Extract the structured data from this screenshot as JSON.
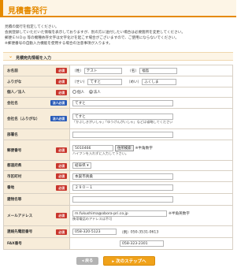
{
  "page_title": "見積書発行",
  "intro": [
    "見積の発行を指定してください。",
    "会員登録していただいた情報を表示しておりますが、別の方に送付したい場合は必要箇所を変更してください。",
    "郵便ＥＮＤ◎ 等の機種依存文字は文字化けを起こす場合がございますので、ご使用にならないでください。",
    "※郵便番号の自動入力機能を使用する場合の注意事項が入ります。"
  ],
  "section_title": "見積宛先情報を入力",
  "badges": {
    "required": "必須",
    "corp_required": "法人必須"
  },
  "form": {
    "name": {
      "label": "お名前",
      "sei_prefix": "（姓）",
      "sei": "テスト",
      "mei_prefix": "（名）",
      "mei": "福島"
    },
    "kana": {
      "label": "ふりがな",
      "sei_prefix": "（せい）",
      "sei": "てすと",
      "mei_prefix": "（めい）",
      "mei": "ふくしま"
    },
    "type": {
      "label": "個人／法人",
      "opt1": "個人",
      "opt2": "法人"
    },
    "company": {
      "label": "会社名",
      "value": "てすと"
    },
    "company_kana": {
      "label": "会社名（ふりがな）",
      "value": "てすと",
      "note": "「かぶしきがいしゃ」「ゆうげんがいしゃ」などは省略してください"
    },
    "department": {
      "label": "部署名"
    },
    "zip": {
      "label": "郵便番号",
      "value": "5010466",
      "button": "住所検索",
      "note1": "※半角数字",
      "note2": "ハイフンを入れずに入力して下さい。"
    },
    "prefecture": {
      "label": "都道府県",
      "value": "岐阜県"
    },
    "city": {
      "label": "市区町村",
      "value": "本巣市真桑"
    },
    "address": {
      "label": "番地",
      "value": "２９０－１"
    },
    "building": {
      "label": "建物名等"
    },
    "email": {
      "label": "メールアドレス",
      "value": "m.fukushima@obora-pri.co.jp",
      "note1": "※半角英数字",
      "note2": "携帯電話のアドレスは不可"
    },
    "tel": {
      "label": "連絡先電話番号",
      "value": "058-320-5123",
      "sub_prefix": "（例）",
      "sub": "050-3531-0613"
    },
    "fax": {
      "label": "FAX番号",
      "value": "058-323-2301"
    }
  },
  "buttons": {
    "back": "戻る",
    "next": "次のステップへ"
  }
}
